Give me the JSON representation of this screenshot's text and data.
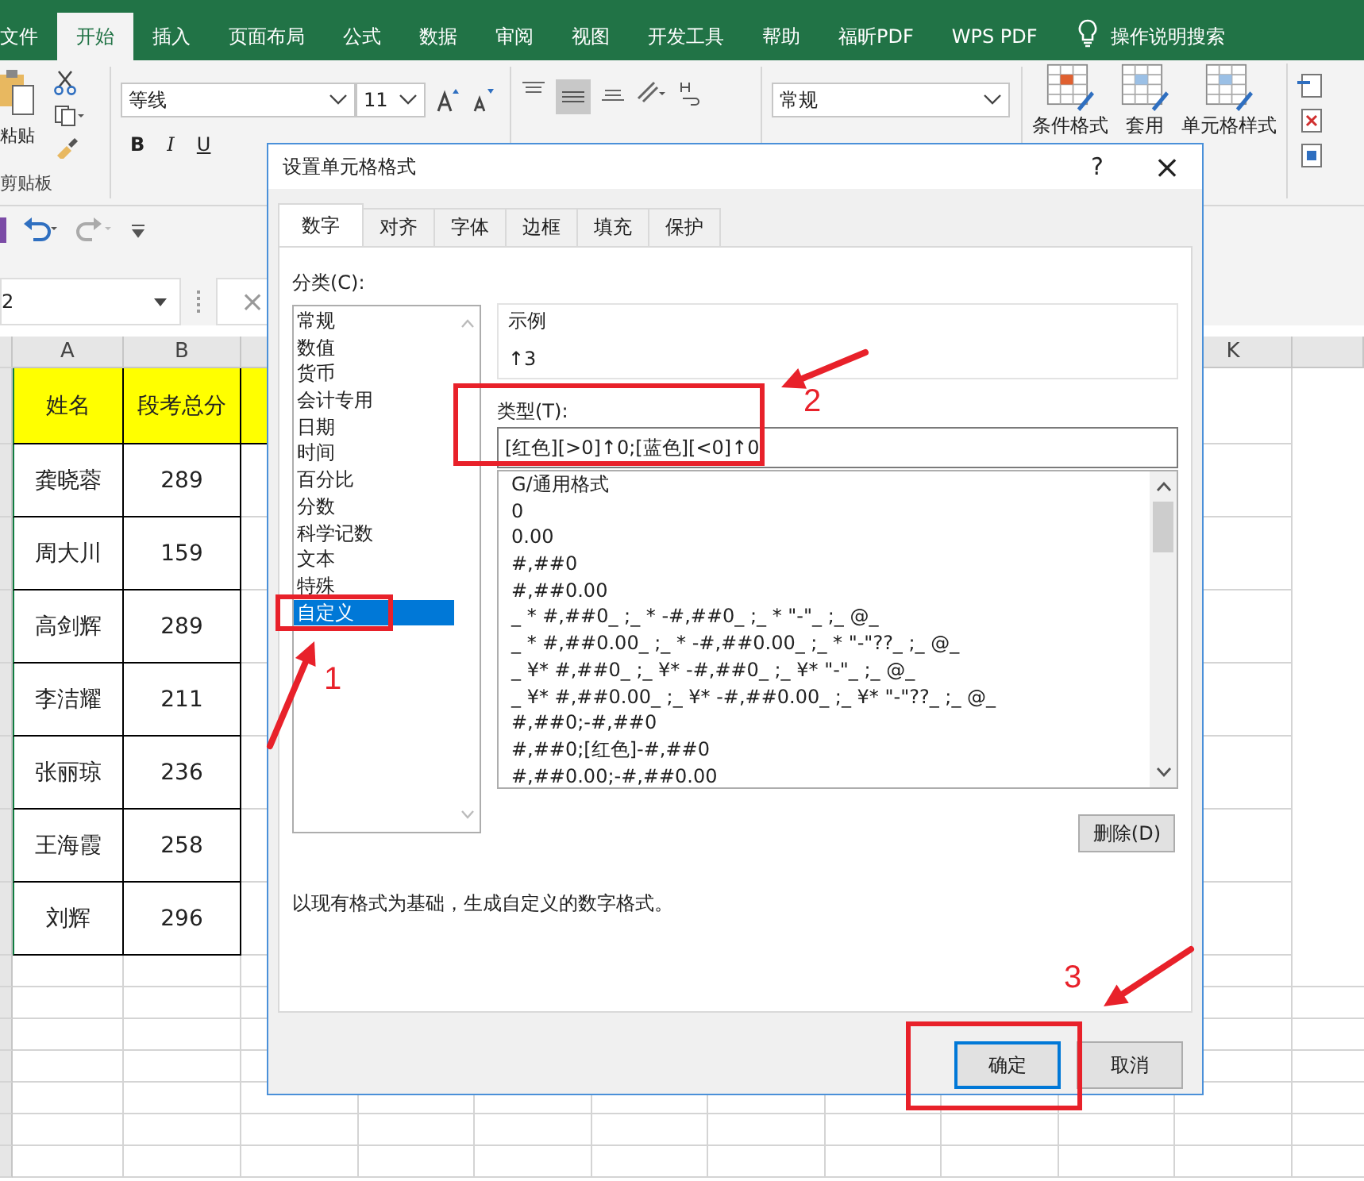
{
  "ribbon": {
    "tabs": [
      {
        "label": "文件",
        "selected": false
      },
      {
        "label": "开始",
        "selected": true
      },
      {
        "label": "插入",
        "selected": false
      },
      {
        "label": "页面布局",
        "selected": false
      },
      {
        "label": "公式",
        "selected": false
      },
      {
        "label": "数据",
        "selected": false
      },
      {
        "label": "审阅",
        "selected": false
      },
      {
        "label": "视图",
        "selected": false
      },
      {
        "label": "开发工具",
        "selected": false
      },
      {
        "label": "帮助",
        "selected": false
      },
      {
        "label": "福昕PDF",
        "selected": false
      },
      {
        "label": "WPS PDF",
        "selected": false
      }
    ],
    "search": "操作说明搜索",
    "paste": "粘贴",
    "clipboard_group": "剪贴板",
    "font_name": "等线",
    "font_size": "11",
    "bold": "B",
    "italic": "I",
    "underline": "U",
    "number_format": "常规",
    "styles": [
      "条件格式",
      "套用",
      "单元格样式"
    ]
  },
  "name_box": "2",
  "cancel_entry": "×",
  "sheet": {
    "columns": [
      "A",
      "B",
      "K"
    ],
    "header": [
      "姓名",
      "段考总分"
    ],
    "rows": [
      [
        "龚晓蓉",
        "289"
      ],
      [
        "周大川",
        "159"
      ],
      [
        "高剑辉",
        "289"
      ],
      [
        "李洁耀",
        "211"
      ],
      [
        "张丽琼",
        "236"
      ],
      [
        "王海霞",
        "258"
      ],
      [
        "刘辉",
        "296"
      ]
    ]
  },
  "dialog": {
    "title": "设置单元格格式",
    "help": "?",
    "close": "×",
    "tabs": [
      {
        "label": "数字",
        "selected": true
      },
      {
        "label": "对齐",
        "selected": false
      },
      {
        "label": "字体",
        "selected": false
      },
      {
        "label": "边框",
        "selected": false
      },
      {
        "label": "填充",
        "selected": false
      },
      {
        "label": "保护",
        "selected": false
      }
    ],
    "category_label": "分类(C):",
    "categories": [
      {
        "label": "常规",
        "selected": false
      },
      {
        "label": "数值",
        "selected": false
      },
      {
        "label": "货币",
        "selected": false
      },
      {
        "label": "会计专用",
        "selected": false
      },
      {
        "label": "日期",
        "selected": false
      },
      {
        "label": "时间",
        "selected": false
      },
      {
        "label": "百分比",
        "selected": false
      },
      {
        "label": "分数",
        "selected": false
      },
      {
        "label": "科学记数",
        "selected": false
      },
      {
        "label": "文本",
        "selected": false
      },
      {
        "label": "特殊",
        "selected": false
      },
      {
        "label": "自定义",
        "selected": true
      }
    ],
    "sample_label": "示例",
    "sample": "↑3",
    "type_label": "类型(T):",
    "type_value": "[红色][>0]↑0;[蓝色][<0]↑0",
    "formats": [
      "G/通用格式",
      "0",
      "0.00",
      "#,##0",
      "#,##0.00",
      "_ * #,##0_ ;_ * -#,##0_ ;_ * \"-\"_ ;_ @_",
      "_ * #,##0.00_ ;_ * -#,##0.00_ ;_ * \"-\"??_ ;_ @_",
      "_ ¥* #,##0_ ;_ ¥* -#,##0_ ;_ ¥* \"-\"_ ;_ @_",
      "_ ¥* #,##0.00_ ;_ ¥* -#,##0.00_ ;_ ¥* \"-\"??_ ;_ @_",
      "#,##0;-#,##0",
      "#,##0;[红色]-#,##0",
      "#,##0.00;-#,##0.00"
    ],
    "delete": "删除(D)",
    "description": "以现有格式为基础，生成自定义的数字格式。",
    "buttons": [
      {
        "label": "确定",
        "default": true
      },
      {
        "label": "取消",
        "default": false
      }
    ]
  },
  "annotations": [
    {
      "label": "1"
    },
    {
      "label": "2"
    },
    {
      "label": "3"
    }
  ]
}
